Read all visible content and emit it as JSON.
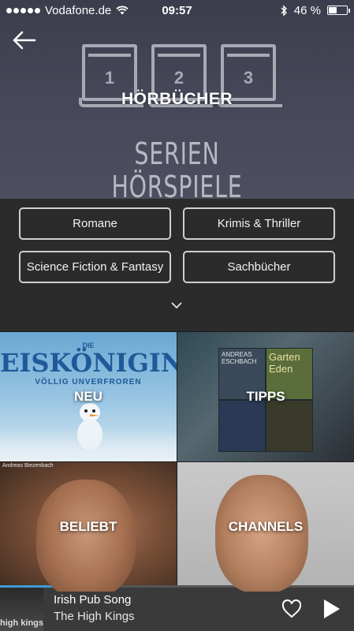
{
  "status_bar": {
    "carrier": "Vodafone.de",
    "time": "09:57",
    "battery": "46 %",
    "battery_level": 0.46
  },
  "header": {
    "back_icon": "arrow-left-icon",
    "title": "HÖRBÜCHER",
    "book_numbers": [
      "1",
      "2",
      "3"
    ],
    "subtitle_line1": "SERIEN",
    "subtitle_line2": "HÖRSPIELE"
  },
  "categories": [
    {
      "label": "Romane"
    },
    {
      "label": "Krimis & Thriller"
    },
    {
      "label": "Science Fiction & Fantasy"
    },
    {
      "label": "Sachbücher"
    }
  ],
  "expand_icon": "chevron-down-icon",
  "tiles": {
    "new": {
      "label": "NEU",
      "art_title": "EISKÖNIGIN",
      "art_small": "DIE",
      "art_sub": "VÖLLIG UNVERFROREN"
    },
    "tips": {
      "label": "TIPPS",
      "book_author": "ANDREAS ESCHBACH",
      "book_title": "Garten Eden"
    },
    "popular": {
      "label": "BELIEBT",
      "credit": "Andreas Biezenbach"
    },
    "channels": {
      "label": "CHANNELS"
    }
  },
  "player": {
    "title": "Irish Pub Song",
    "artist": "The High Kings",
    "cover_text": "high kings",
    "progress": 0.32,
    "accent_color": "#3f9ad8",
    "heart_icon": "heart-icon",
    "play_icon": "play-icon"
  }
}
